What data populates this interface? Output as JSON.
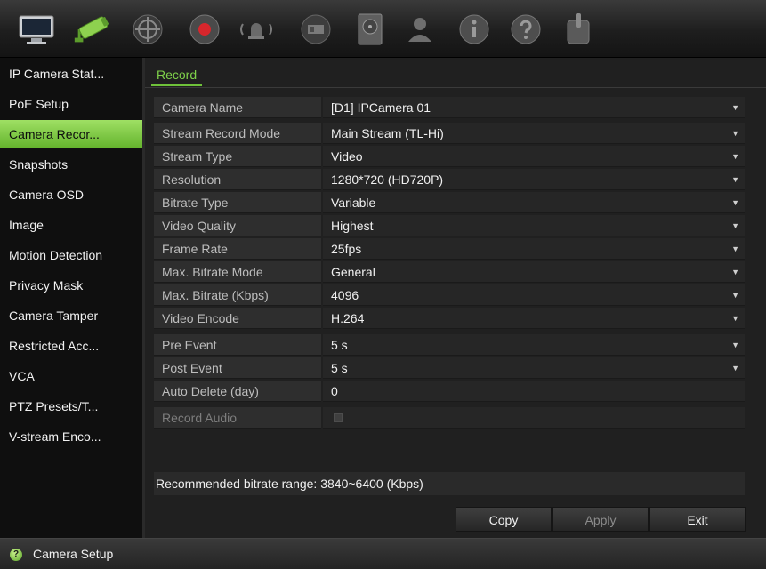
{
  "toolbar": {
    "icons": [
      {
        "name": "display-monitor-icon",
        "active": false
      },
      {
        "name": "camera-icon",
        "active": true
      },
      {
        "name": "network-icon",
        "active": false
      },
      {
        "name": "record-icon",
        "active": false
      },
      {
        "name": "alarm-icon",
        "active": false
      },
      {
        "name": "device-icon",
        "active": false
      },
      {
        "name": "storage-icon",
        "active": false
      },
      {
        "name": "user-icon",
        "active": false
      },
      {
        "name": "system-info-icon",
        "active": false
      },
      {
        "name": "help-icon",
        "active": false
      },
      {
        "name": "power-icon",
        "active": false
      }
    ]
  },
  "sidebar": {
    "items": [
      {
        "label": "IP Camera Stat..."
      },
      {
        "label": "PoE Setup"
      },
      {
        "label": "Camera Recor...",
        "active": true
      },
      {
        "label": "Snapshots"
      },
      {
        "label": "Camera OSD"
      },
      {
        "label": "Image"
      },
      {
        "label": "Motion Detection"
      },
      {
        "label": "Privacy Mask"
      },
      {
        "label": "Camera Tamper"
      },
      {
        "label": "Restricted Acc..."
      },
      {
        "label": "VCA"
      },
      {
        "label": "PTZ Presets/T..."
      },
      {
        "label": "V-stream Enco..."
      }
    ]
  },
  "tab": {
    "label": "Record"
  },
  "form": {
    "rows": [
      {
        "label": "Camera Name",
        "value": "[D1] IPCamera 01",
        "dropdown": true
      },
      {
        "label": "Stream Record Mode",
        "value": "Main Stream (TL-Hi)",
        "dropdown": true
      },
      {
        "label": "Stream Type",
        "value": "Video",
        "dropdown": true
      },
      {
        "label": "Resolution",
        "value": "1280*720 (HD720P)",
        "dropdown": true
      },
      {
        "label": "Bitrate Type",
        "value": "Variable",
        "dropdown": true
      },
      {
        "label": "Video Quality",
        "value": "Highest",
        "dropdown": true
      },
      {
        "label": "Frame Rate",
        "value": "25fps",
        "dropdown": true
      },
      {
        "label": "Max. Bitrate Mode",
        "value": "General",
        "dropdown": true
      },
      {
        "label": "Max. Bitrate (Kbps)",
        "value": "4096",
        "dropdown": true
      },
      {
        "label": "Video Encode",
        "value": "H.264",
        "dropdown": true
      },
      {
        "label": "Pre Event",
        "value": "5 s",
        "dropdown": true
      },
      {
        "label": "Post Event",
        "value": "5 s",
        "dropdown": true
      },
      {
        "label": "Auto Delete (day)",
        "value": "0",
        "dropdown": false
      },
      {
        "label": "Record Audio",
        "value": "",
        "dropdown": false,
        "disabled": true
      }
    ]
  },
  "info": {
    "text": "Recommended bitrate range: 3840~6400 (Kbps)"
  },
  "buttons": {
    "copy": "Copy",
    "apply": "Apply",
    "exit": "Exit"
  },
  "status": {
    "text": "Camera Setup",
    "icon_glyph": "?"
  },
  "colors": {
    "accent": "#7fd24a",
    "active_item": "#8fd457"
  }
}
